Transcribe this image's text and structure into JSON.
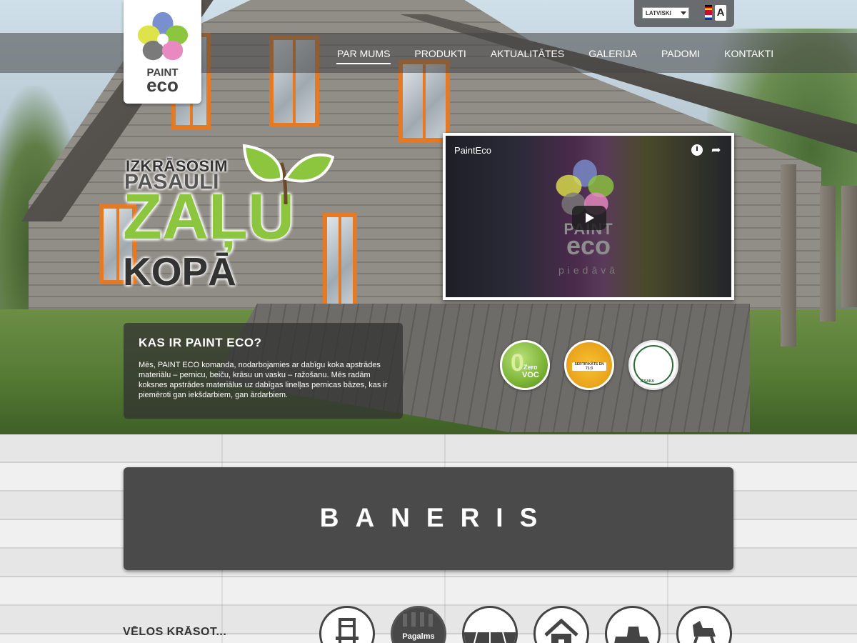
{
  "header": {
    "logo": {
      "line1": "PAINT",
      "line2": "eco"
    },
    "nav": [
      {
        "label": "PAR MUMS",
        "active": true
      },
      {
        "label": "PRODUKTI",
        "active": false
      },
      {
        "label": "AKTUALITĀTES",
        "active": false
      },
      {
        "label": "GALERIJA",
        "active": false
      },
      {
        "label": "PADOMI",
        "active": false
      },
      {
        "label": "KONTAKTI",
        "active": false
      }
    ],
    "language": {
      "selected": "LATVISKI"
    },
    "accessibility_icon": "font-size-icon"
  },
  "slogan": {
    "line1": "IZKRĀSOSIM",
    "line2": "PASAULI",
    "line3": "ZAĻU",
    "line4": "KOPĀ"
  },
  "video": {
    "title": "PaintEco",
    "brand1": "PAINT",
    "brand2": "eco",
    "subtitle": "piedāvā"
  },
  "info": {
    "title": "KAS IR PAINT ECO?",
    "text": "Mēs, PAINT ECO komanda, nodarbojamies ar dabīgu koka apstrādes materiālu – pernicu, beiču, krāsu un vasku – ražošanu. Mēs radām koksnes apstrādes materiālus uz dabīgas linelļas pernicas bāzes, kas ir piemēroti gan iekšdarbiem, gan ārdarbiem."
  },
  "badges": {
    "voc": {
      "num": "0",
      "l1": "Zero",
      "l2": "VOC"
    },
    "cert": {
      "text": "SERTIFIKĀTS EN 71:3"
    },
    "allergy": {
      "text": "IESAKA"
    }
  },
  "banner": {
    "text": "BANERIS"
  },
  "paint_section": {
    "label": "VĒLOS KRĀSOT...",
    "categories": [
      {
        "icon": "chair-icon",
        "label": ""
      },
      {
        "icon": "fence-icon",
        "label": "Pagalms",
        "active": true
      },
      {
        "icon": "floor-icon",
        "label": ""
      },
      {
        "icon": "house-icon",
        "label": ""
      },
      {
        "icon": "plane-tool-icon",
        "label": ""
      },
      {
        "icon": "rocking-horse-icon",
        "label": ""
      }
    ]
  },
  "colors": {
    "accent_green": "#8cc63e",
    "nav_bg": "#464646",
    "window_frame": "#e47b24"
  }
}
